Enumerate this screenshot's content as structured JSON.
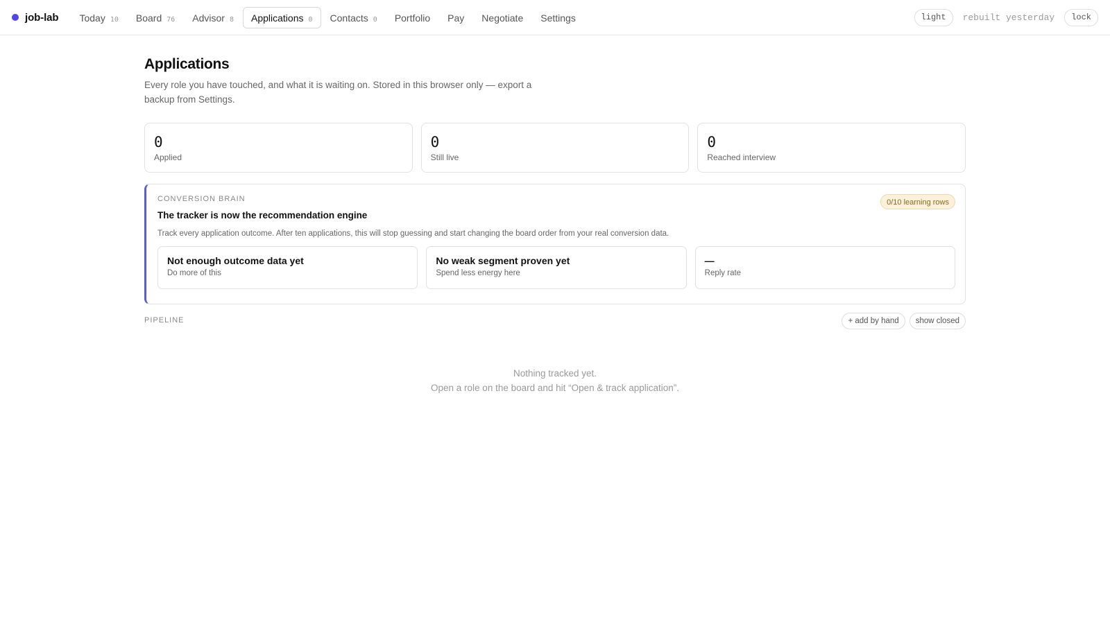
{
  "brand": {
    "name": "job-lab",
    "accent": "#4f46e5"
  },
  "nav": [
    {
      "label": "Today",
      "count": "10"
    },
    {
      "label": "Board",
      "count": "76"
    },
    {
      "label": "Advisor",
      "count": "8"
    },
    {
      "label": "Applications",
      "count": "0"
    },
    {
      "label": "Contacts",
      "count": "0"
    },
    {
      "label": "Portfolio",
      "count": ""
    },
    {
      "label": "Pay",
      "count": ""
    },
    {
      "label": "Negotiate",
      "count": ""
    },
    {
      "label": "Settings",
      "count": ""
    }
  ],
  "active_tab": "Applications",
  "topbar_right": {
    "theme_label": "light",
    "status": "rebuilt yesterday",
    "lock_label": "lock"
  },
  "page": {
    "title": "Applications",
    "description": "Every role you have touched, and what it is waiting on. Stored in this browser only — export a backup from Settings."
  },
  "stats": [
    {
      "value": "0",
      "label": "Applied"
    },
    {
      "value": "0",
      "label": "Still live"
    },
    {
      "value": "0",
      "label": "Reached interview"
    }
  ],
  "brain": {
    "eyebrow": "CONVERSION BRAIN",
    "badge": "0/10 learning rows",
    "title": "The tracker is now the recommendation engine",
    "description": "Track every application outcome. After ten applications, this will stop guessing and start changing the board order from your real conversion data.",
    "cards": [
      {
        "title": "Not enough outcome data yet",
        "sub": "Do more of this"
      },
      {
        "title": "No weak segment proven yet",
        "sub": "Spend less energy here"
      },
      {
        "title": "—",
        "sub": "Reply rate"
      }
    ],
    "accent": "#5b5bd6"
  },
  "pipeline": {
    "label": "PIPELINE",
    "add_label": "+ add by hand",
    "closed_label": "show closed",
    "empty_title": "Nothing tracked yet.",
    "empty_hint": "Open a role on the board and hit “Open & track application”."
  }
}
